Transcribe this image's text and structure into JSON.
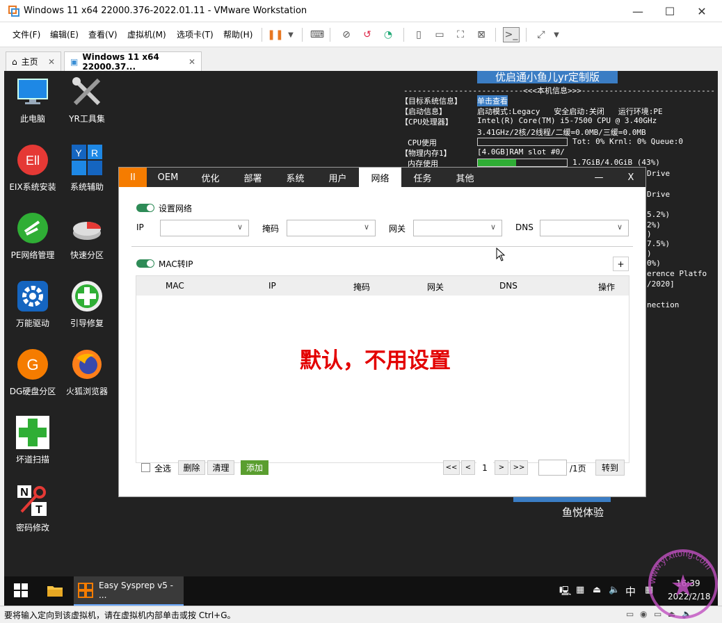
{
  "window": {
    "title": "Windows 11 x64 22000.376-2022.01.11 - VMware Workstation"
  },
  "menu": [
    "文件(F)",
    "编辑(E)",
    "查看(V)",
    "虚拟机(M)",
    "选项卡(T)",
    "帮助(H)"
  ],
  "tabs": [
    {
      "label": "主页"
    },
    {
      "label": "Windows 11 x64 22000.37..."
    }
  ],
  "desktop": {
    "icons": [
      {
        "label": "此电脑",
        "name": "this-pc-icon"
      },
      {
        "label": "YR工具集",
        "name": "tools-icon"
      },
      {
        "label": "EIX系统安装",
        "name": "eix-install-icon"
      },
      {
        "label": "系统辅助",
        "name": "system-assist-icon"
      },
      {
        "label": "PE网络管理",
        "name": "pe-network-icon"
      },
      {
        "label": "快速分区",
        "name": "quick-partition-icon"
      },
      {
        "label": "万能驱动",
        "name": "driver-icon"
      },
      {
        "label": "引导修复",
        "name": "boot-repair-icon"
      },
      {
        "label": "DG硬盘分区",
        "name": "dg-partition-icon"
      },
      {
        "label": "火狐浏览器",
        "name": "firefox-icon"
      },
      {
        "label": "坏道扫描",
        "name": "bad-sector-icon"
      },
      {
        "label": "密码修改",
        "name": "password-icon"
      }
    ],
    "banner": "优启通小鱼儿yr定制版",
    "info_header": "--------------------------<<<本机信息>>>-----------------------------",
    "info": {
      "target_label": "【目标系统信息】",
      "target_value": "单击查看",
      "boot_label": "【启动信息】",
      "boot_value": "启动模式:Legacy   安全启动:关闭   运行环境:PE",
      "cpu_label": "【CPU处理器】",
      "cpu_value1": "Intel(R) Core(TM) i5-7500 CPU @ 3.40GHz",
      "cpu_value2": "3.41GHz/2核/2线程/二缓=0.0MB/三缓=0.0MB",
      "cpu_use_label": "CPU使用",
      "cpu_use_value": "Tot: 0% Krnl: 0% Queue:0",
      "mem_label": "【物理内存1】",
      "mem_value": "[4.0GB]RAM slot #0/",
      "mem_use_label": "内存使用",
      "mem_use_value": "1.7GiB/4.0GiB (43%)",
      "mem_use_fraction": 0.43
    },
    "right_fragments": [
      "Drive",
      "Drive",
      "5.2%)",
      "2%)",
      ")",
      "7.5%)",
      ")",
      "0%)",
      "erence Platfo",
      "/2020]",
      "nection"
    ],
    "watermark_text": "鱼悦体验"
  },
  "dialog": {
    "tabs": [
      "II",
      "OEM",
      "优化",
      "部署",
      "系统",
      "用户",
      "网络",
      "任务",
      "其他"
    ],
    "active_tab": "网络",
    "minimize": "—",
    "close": "X",
    "set_network_label": "设置网络",
    "fields": [
      {
        "label": "IP"
      },
      {
        "label": "掩码"
      },
      {
        "label": "网关"
      },
      {
        "label": "DNS"
      }
    ],
    "mac_label": "MAC转IP",
    "add_symbol": "+",
    "table_headers": [
      "MAC",
      "IP",
      "掩码",
      "网关",
      "DNS",
      "操作"
    ],
    "overlay_text": "默认，不用设置",
    "select_all": "全选",
    "btn_delete": "删除",
    "btn_clear": "清理",
    "btn_add": "添加",
    "pager": {
      "first": "<<",
      "prev": "<",
      "page": "1",
      "next": ">",
      "last": ">>",
      "total": "/1页",
      "goto": "转到"
    }
  },
  "taskbar": {
    "app": "Easy Sysprep v5 - ...",
    "ime": "中",
    "time": "16:39",
    "date": "2022/2/18"
  },
  "status_text": "要将输入定向到该虚拟机，请在虚拟机内部单击或按 Ctrl+G。",
  "stamp_text": "www.yrxitong.com"
}
